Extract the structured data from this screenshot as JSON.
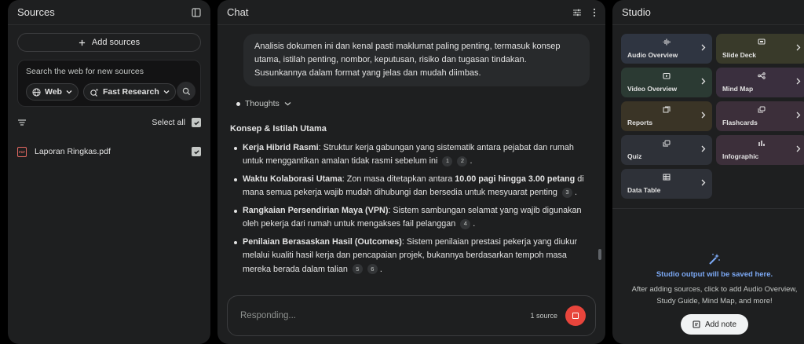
{
  "sources": {
    "title": "Sources",
    "add_label": "Add sources",
    "search_hint": "Search the web for new sources",
    "web_chip": "Web",
    "research_chip": "Fast Research",
    "select_all": "Select all",
    "items": [
      {
        "name": "Laporan Ringkas.pdf",
        "checked": true
      }
    ]
  },
  "chat": {
    "title": "Chat",
    "user_message": "Analisis dokumen ini dan kenal pasti maklumat paling penting, termasuk konsep utama, istilah penting, nombor, keputusan, risiko dan tugasan tindakan. Susunkannya dalam format yang jelas dan mudah diimbas.",
    "thoughts_label": "Thoughts",
    "answer_heading": "Konsep & Istilah Utama",
    "bullets": [
      {
        "term": "Kerja Hibrid Rasmi",
        "text": ": Struktur kerja gabungan yang sistematik antara pejabat dan rumah untuk menggantikan amalan tidak rasmi sebelum ini",
        "cites": [
          "1",
          "2"
        ]
      },
      {
        "term": "Waktu Kolaborasi Utama",
        "text_before": ": Zon masa ditetapkan antara ",
        "bold_mid": "10.00 pagi hingga 3.00 petang",
        "text_after": " di mana semua pekerja wajib mudah dihubungi dan bersedia untuk mesyuarat penting",
        "cites": [
          "3"
        ]
      },
      {
        "term": "Rangkaian Persendirian Maya (VPN)",
        "text": ": Sistem sambungan selamat yang wajib digunakan oleh pekerja dari rumah untuk mengakses fail pelanggan",
        "cites": [
          "4"
        ]
      },
      {
        "term": "Penilaian Berasaskan Hasil (Outcomes)",
        "text": ": Sistem penilaian prestasi pekerja yang diukur melalui kualiti hasil kerja dan pencapaian projek, bukannya berdasarkan tempoh masa mereka berada dalam talian",
        "cites": [
          "5",
          "6"
        ]
      }
    ],
    "composer_placeholder": "Responding...",
    "source_count": "1 source"
  },
  "studio": {
    "title": "Studio",
    "tiles": [
      {
        "label": "Audio Overview",
        "icon": "audio-wave-icon"
      },
      {
        "label": "Slide Deck",
        "icon": "slides-icon"
      },
      {
        "label": "Video Overview",
        "icon": "video-icon"
      },
      {
        "label": "Mind Map",
        "icon": "mind-map-icon"
      },
      {
        "label": "Reports",
        "icon": "report-icon"
      },
      {
        "label": "Flashcards",
        "icon": "flashcards-icon"
      },
      {
        "label": "Quiz",
        "icon": "quiz-icon"
      },
      {
        "label": "Infographic",
        "icon": "infographic-icon"
      },
      {
        "label": "Data Table",
        "icon": "table-icon"
      }
    ],
    "empty_title": "Studio output will be saved here.",
    "empty_desc": "After adding sources, click to add Audio Overview, Study Guide, Mind Map, and more!",
    "add_note": "Add note"
  }
}
